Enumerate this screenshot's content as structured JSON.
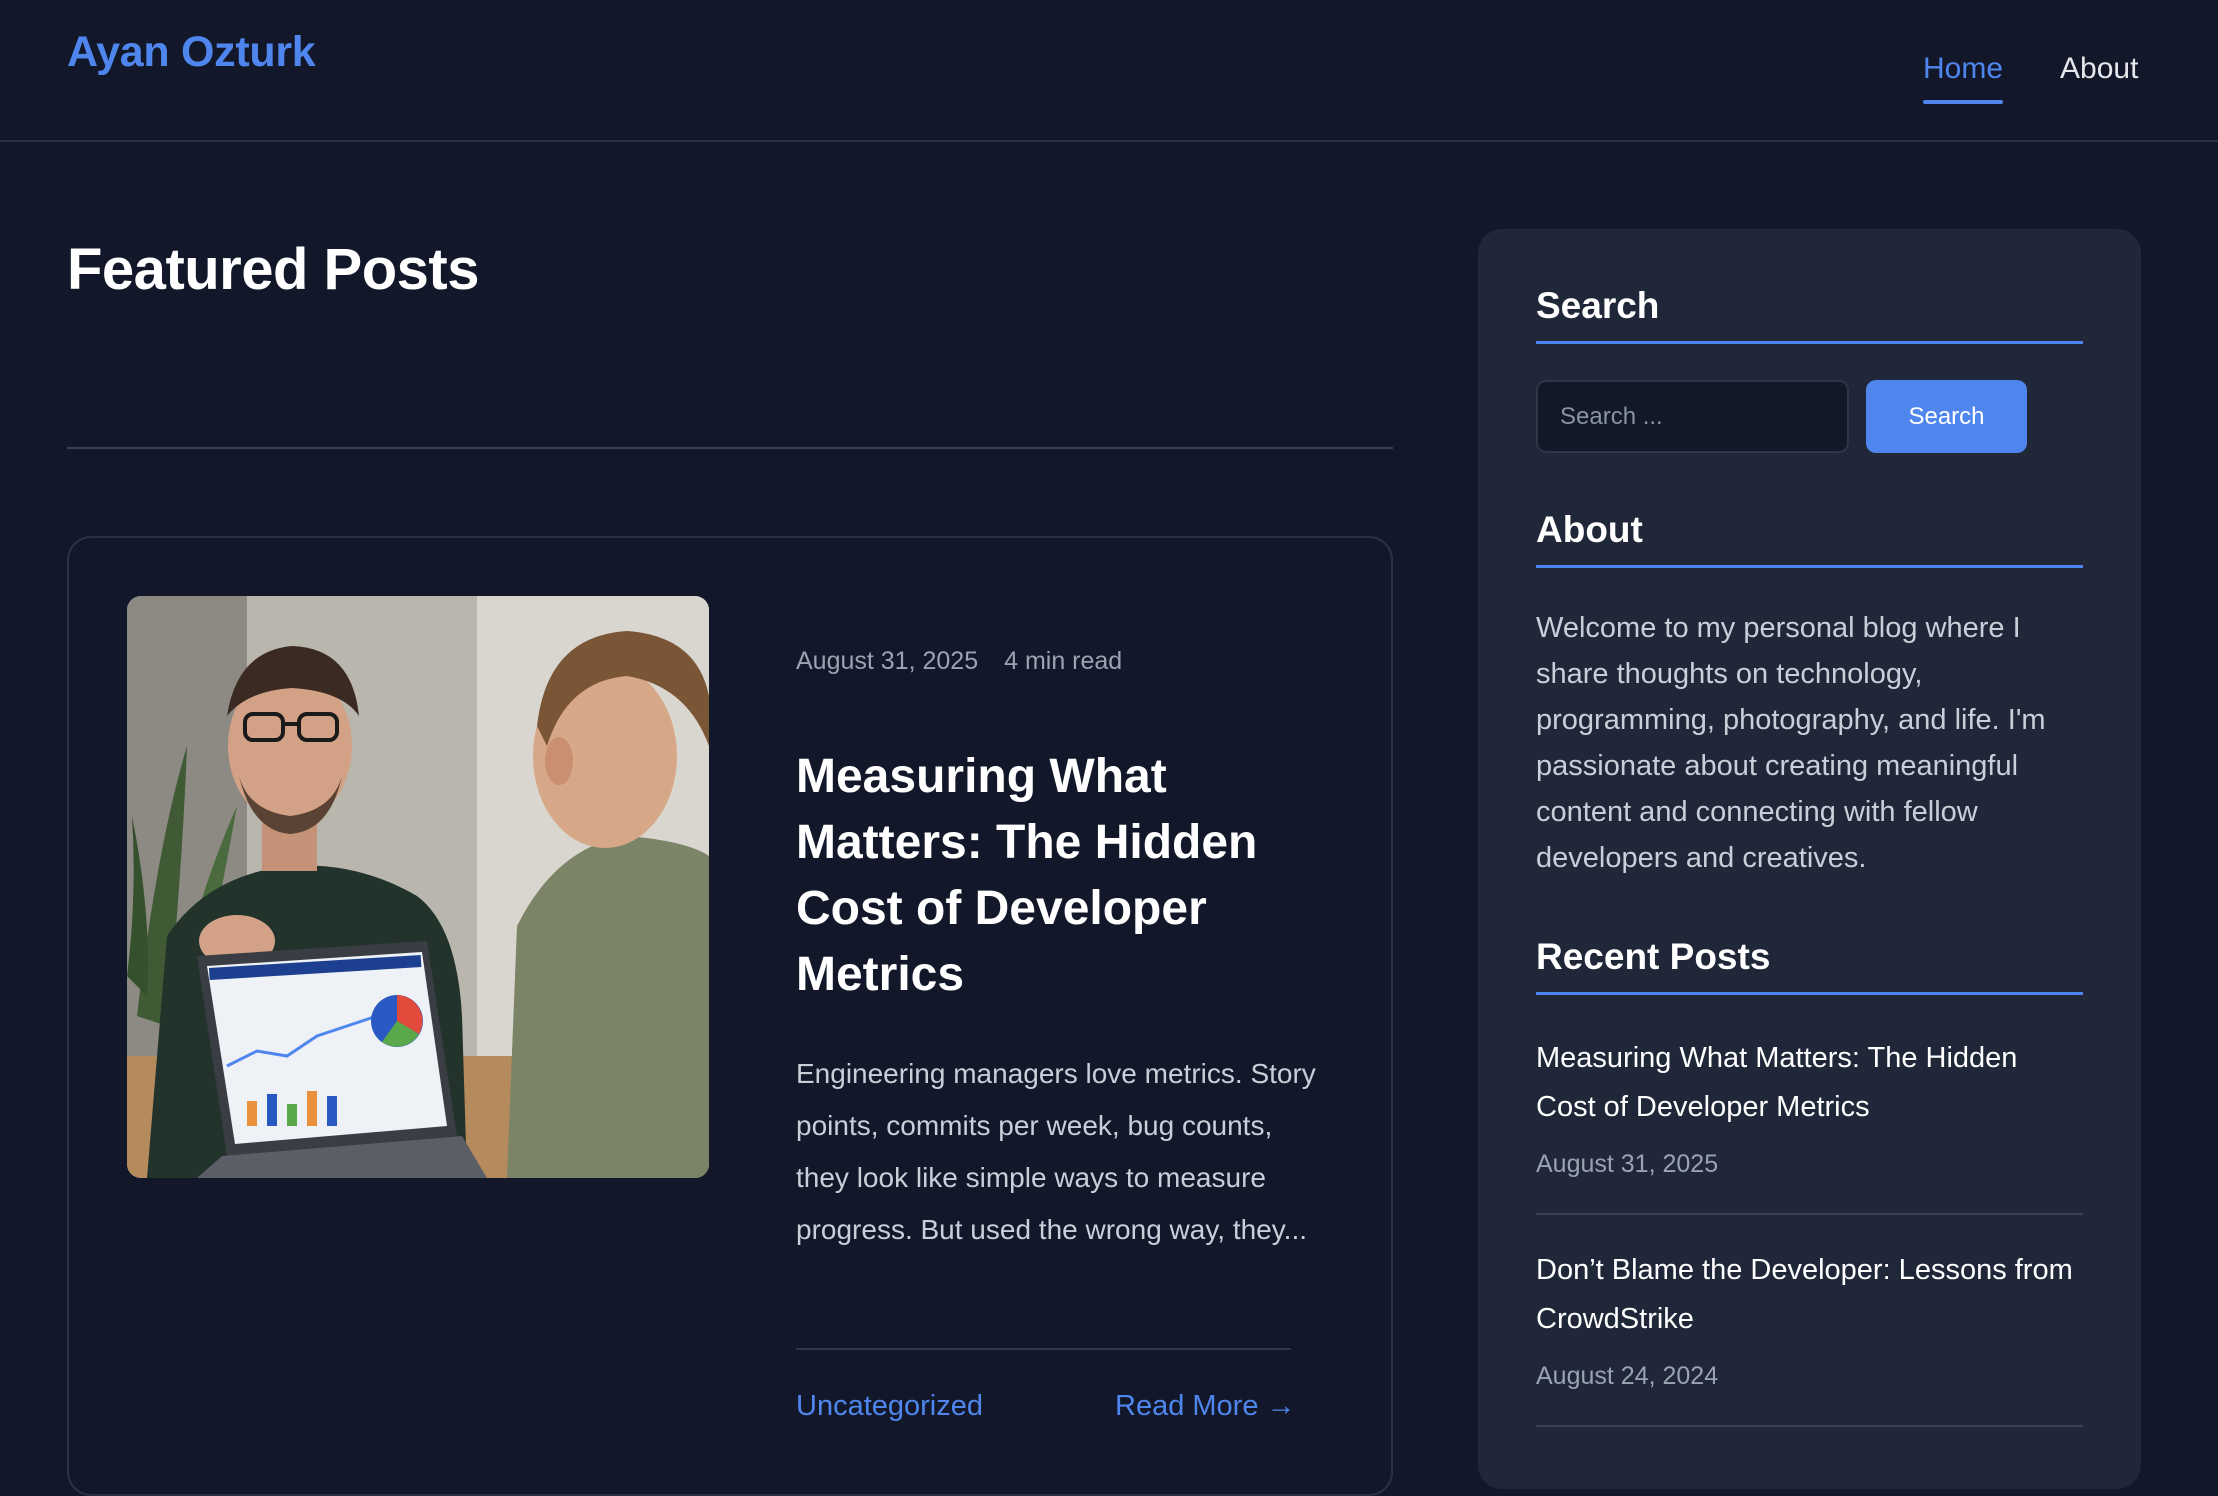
{
  "header": {
    "site_title": "Ayan Ozturk",
    "nav": [
      {
        "label": "Home",
        "active": true
      },
      {
        "label": "About",
        "active": false
      }
    ]
  },
  "main": {
    "section_title": "Featured Posts",
    "featured_post": {
      "date": "August 31, 2025",
      "read_time": "4 min read",
      "title": "Measuring What Matters: The Hidden Cost of Developer Metrics",
      "excerpt": "Engineering managers love metrics. Story points, commits per week, bug counts, they look like simple ways to measure progress. But used the wrong way, they...",
      "category": "Uncategorized",
      "read_more": "Read More →"
    }
  },
  "sidebar": {
    "search": {
      "title": "Search",
      "placeholder": "Search ...",
      "button_label": "Search"
    },
    "about": {
      "title": "About",
      "text": "Welcome to my personal blog where I share thoughts on technology, programming, photography, and life. I'm passionate about creating meaningful content and connecting with fellow developers and creatives."
    },
    "recent_posts": {
      "title": "Recent Posts",
      "items": [
        {
          "title": "Measuring What Matters: The Hidden Cost of Developer Metrics",
          "date": "August 31, 2025"
        },
        {
          "title": "Don’t Blame the Developer: Lessons from CrowdStrike",
          "date": "August 24, 2024"
        }
      ]
    }
  },
  "colors": {
    "background": "#121829",
    "accent": "#4f86ee",
    "sidebar_bg": "#1f2738"
  }
}
